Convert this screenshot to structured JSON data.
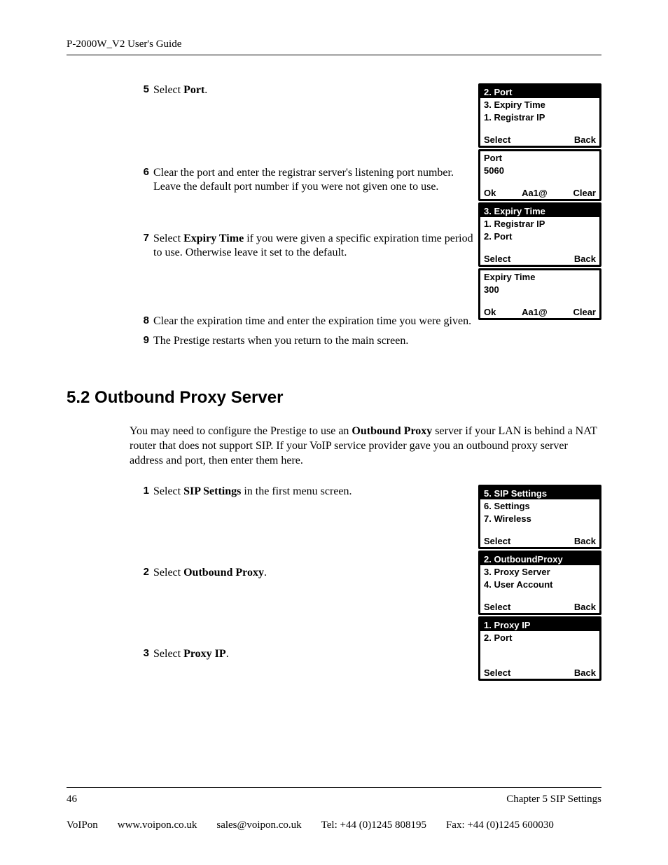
{
  "header": {
    "title": "P-2000W_V2 User's Guide"
  },
  "steps_a": [
    {
      "num": "5",
      "pre": "Select ",
      "bold": "Port",
      "post": "."
    },
    {
      "num": "6",
      "pre": "Clear the port and enter the registrar server's listening port number. Leave the default port number if you were not given one to use.",
      "bold": "",
      "post": ""
    },
    {
      "num": "7",
      "pre": "Select ",
      "bold": "Expiry Time",
      "post": " if you were given a specific expiration time period to use. Otherwise leave it set to the default."
    },
    {
      "num": "8",
      "pre": "Clear the expiration time and enter the expiration time you were given.",
      "bold": "",
      "post": ""
    },
    {
      "num": "9",
      "pre": "The Prestige restarts when you return to the main screen.",
      "bold": "",
      "post": ""
    }
  ],
  "screens_a": [
    {
      "hi": "2. Port",
      "l1": "3. Expiry Time",
      "l2": "1. Registrar IP",
      "bl": "Select",
      "bc": "",
      "br": "Back"
    },
    {
      "hi": "",
      "l1": "Port",
      "l2": "5060",
      "bl": "Ok",
      "bc": "Aa1@",
      "br": "Clear",
      "no_hi": true
    },
    {
      "hi": "3. Expiry Time",
      "l1": "1. Registrar IP",
      "l2": "2. Port",
      "bl": "Select",
      "bc": "",
      "br": "Back"
    },
    {
      "hi": "",
      "l1": "Expiry Time",
      "l2": "300",
      "bl": "Ok",
      "bc": "Aa1@",
      "br": "Clear",
      "no_hi": true
    }
  ],
  "section": {
    "heading": "5.2  Outbound Proxy Server",
    "intro_pre": "You may need to configure the Prestige to use an ",
    "intro_bold": "Outbound Proxy",
    "intro_post": " server if your LAN is behind a NAT router that does not support SIP.  If your VoIP service provider gave you an outbound proxy server address and port, then enter them here."
  },
  "steps_b": [
    {
      "num": "1",
      "pre": "Select ",
      "bold": "SIP Settings",
      "post": " in the first menu screen."
    },
    {
      "num": "2",
      "pre": "Select ",
      "bold": "Outbound Proxy",
      "post": "."
    },
    {
      "num": "3",
      "pre": "Select ",
      "bold": "Proxy IP",
      "post": "."
    }
  ],
  "screens_b": [
    {
      "hi": "5. SIP Settings",
      "l1": "6. Settings",
      "l2": "7. Wireless",
      "bl": "Select",
      "bc": "",
      "br": "Back"
    },
    {
      "hi": "2. OutboundProxy",
      "l1": "3. Proxy Server",
      "l2": "4. User Account",
      "bl": "Select",
      "bc": "",
      "br": "Back"
    },
    {
      "hi": "1. Proxy IP",
      "l1": "2. Port",
      "l2": "",
      "bl": "Select",
      "bc": "",
      "br": "Back"
    }
  ],
  "footer": {
    "page": "46",
    "chapter": "Chapter 5 SIP Settings",
    "org": "VoIPon",
    "web": "www.voipon.co.uk",
    "email": "sales@voipon.co.uk",
    "tel": "Tel: +44 (0)1245 808195",
    "fax": "Fax: +44 (0)1245 600030"
  }
}
